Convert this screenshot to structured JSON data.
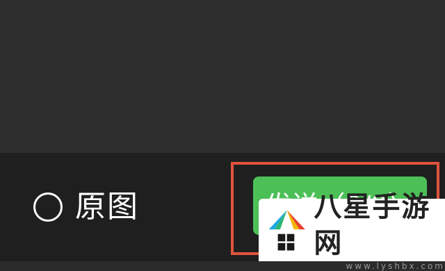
{
  "bottom_bar": {
    "original_label": "原图",
    "send_label": "发送（9/9）"
  },
  "watermark": {
    "name": "八星手游网",
    "url": "www.lyshbx.com"
  },
  "colors": {
    "bar_bg": "#1f1f1f",
    "preview_bg": "#2d2d2d",
    "send_green": "#4cbf57",
    "highlight_red": "#e0533c"
  },
  "icons": [
    "radio-unchecked-icon",
    "site-logo-icon"
  ]
}
